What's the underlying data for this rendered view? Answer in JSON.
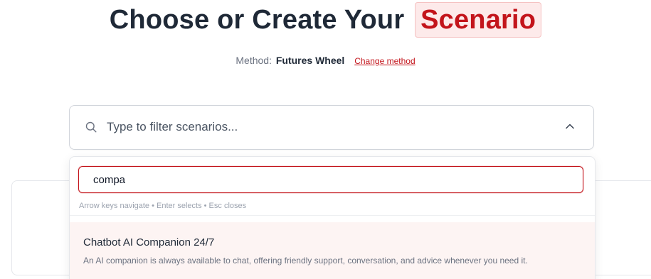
{
  "header": {
    "title_prefix": "Choose or Create Your",
    "title_highlight": "Scenario"
  },
  "method": {
    "label": "Method:",
    "name": "Futures Wheel",
    "change_link": "Change method"
  },
  "filter": {
    "placeholder": "Type to filter scenarios..."
  },
  "dropdown": {
    "query_value": "compa",
    "hint": "Arrow keys navigate • Enter selects • Esc closes",
    "options": [
      {
        "title": "Chatbot AI Companion 24/7",
        "description": "An AI companion is always available to chat, offering friendly support, conversation, and advice whenever you need it."
      }
    ]
  },
  "colors": {
    "accent": "#c3141b",
    "highlight_bg": "#fdeaea",
    "option_hover_bg": "#fdf4f3",
    "text_dark": "#1f2937"
  }
}
